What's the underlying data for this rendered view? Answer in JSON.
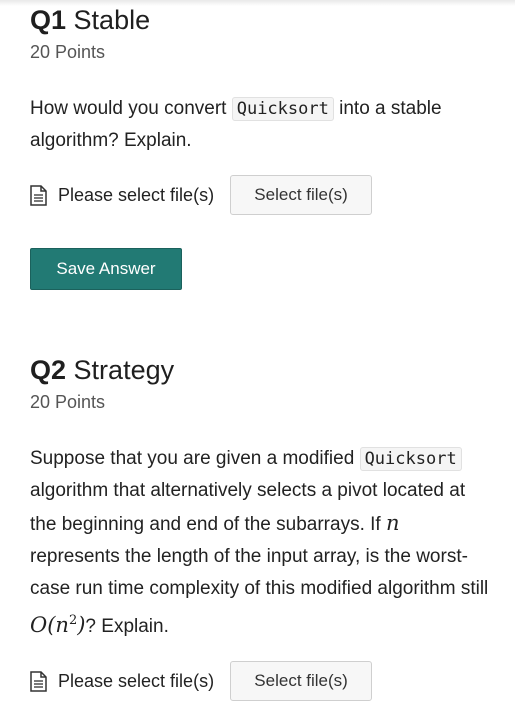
{
  "questions": [
    {
      "number": "Q1",
      "title": "Stable",
      "points": "20 Points",
      "text_before": "How would you convert ",
      "code": "Quicksort",
      "text_after": " into a stable algorithm? Explain.",
      "upload_label": "Please select file(s)",
      "select_button": "Select file(s)",
      "save_button": "Save Answer"
    },
    {
      "number": "Q2",
      "title": "Strategy",
      "points": "20 Points",
      "text_1": "Suppose that you are given a modified ",
      "code": "Quicksort",
      "text_2": " algorithm that alternatively selects a pivot located at the beginning and end of the subarrays. If ",
      "math_var": "n",
      "text_3": " represents the length of the input array, is the worst-case run time complexity of this modified algorithm still ",
      "math_big_o": "O(n",
      "math_exp": "2",
      "math_close": ")",
      "text_4": "? Explain.",
      "upload_label": "Please select file(s)",
      "select_button": "Select file(s)"
    }
  ]
}
